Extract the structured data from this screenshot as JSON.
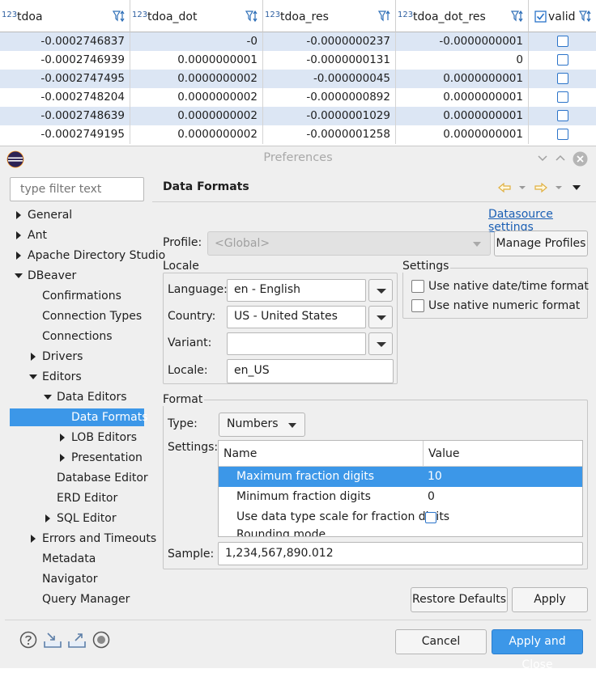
{
  "grid": {
    "columns": [
      {
        "type_badge": "123",
        "name": "tdoa"
      },
      {
        "type_badge": "123",
        "name": "tdoa_dot"
      },
      {
        "type_badge": "123",
        "name": "tdoa_res"
      },
      {
        "type_badge": "123",
        "name": "tdoa_dot_res"
      },
      {
        "type_badge": "",
        "name": "valid"
      }
    ],
    "rows": [
      [
        "-0.0002746837",
        "-0",
        "-0.0000000237",
        "-0.0000000001"
      ],
      [
        "-0.0002746939",
        "0.0000000001",
        "-0.0000000131",
        "0"
      ],
      [
        "-0.0002747495",
        "0.0000000002",
        "-0.000000045",
        "0.0000000001"
      ],
      [
        "-0.0002748204",
        "0.0000000002",
        "-0.0000000892",
        "0.0000000001"
      ],
      [
        "-0.0002748639",
        "0.0000000002",
        "-0.0000001029",
        "0.0000000001"
      ],
      [
        "-0.0002749195",
        "0.0000000002",
        "-0.0000001258",
        "0.0000000001"
      ]
    ]
  },
  "dialog": {
    "title": "Preferences",
    "filter_placeholder": "type filter text",
    "tree": [
      {
        "label": "General",
        "level": 0,
        "arrow": "right"
      },
      {
        "label": "Ant",
        "level": 0,
        "arrow": "right"
      },
      {
        "label": "Apache Directory Studio",
        "level": 0,
        "arrow": "right"
      },
      {
        "label": "DBeaver",
        "level": 0,
        "arrow": "down"
      },
      {
        "label": "Confirmations",
        "level": 1,
        "arrow": ""
      },
      {
        "label": "Connection Types",
        "level": 1,
        "arrow": ""
      },
      {
        "label": "Connections",
        "level": 1,
        "arrow": ""
      },
      {
        "label": "Drivers",
        "level": 1,
        "arrow": "right"
      },
      {
        "label": "Editors",
        "level": 1,
        "arrow": "down"
      },
      {
        "label": "Data Editors",
        "level": 2,
        "arrow": "down"
      },
      {
        "label": "Data Formats",
        "level": 3,
        "arrow": "",
        "selected": true
      },
      {
        "label": "LOB Editors",
        "level": 3,
        "arrow": "right"
      },
      {
        "label": "Presentation",
        "level": 3,
        "arrow": "right"
      },
      {
        "label": "Database Editor",
        "level": 2,
        "arrow": ""
      },
      {
        "label": "ERD Editor",
        "level": 2,
        "arrow": ""
      },
      {
        "label": "SQL Editor",
        "level": 2,
        "arrow": "right"
      },
      {
        "label": "Errors and Timeouts",
        "level": 1,
        "arrow": "right"
      },
      {
        "label": "Metadata",
        "level": 1,
        "arrow": ""
      },
      {
        "label": "Navigator",
        "level": 1,
        "arrow": ""
      },
      {
        "label": "Query Manager",
        "level": 1,
        "arrow": ""
      }
    ],
    "page_title": "Data Formats",
    "datasource_link": "Datasource settings",
    "profile_label": "Profile:",
    "profile_value": "<Global>",
    "manage_profiles": "Manage Profiles",
    "locale": {
      "group": "Locale",
      "language_label": "Language:",
      "language_value": "en - English",
      "country_label": "Country:",
      "country_value": "US - United States",
      "variant_label": "Variant:",
      "variant_value": "",
      "locale_label": "Locale:",
      "locale_value": "en_US"
    },
    "settings": {
      "group": "Settings",
      "native_datetime": "Use native date/time format",
      "native_numeric": "Use native numeric format"
    },
    "format": {
      "group": "Format",
      "type_label": "Type:",
      "type_value": "Numbers",
      "settings_label": "Settings:",
      "col_name": "Name",
      "col_value": "Value",
      "rows": [
        {
          "name": "Maximum fraction digits",
          "value": "10"
        },
        {
          "name": "Minimum fraction digits",
          "value": "0"
        },
        {
          "name": "Use data type scale for fraction digits",
          "value": ""
        },
        {
          "name": "Rounding mode",
          "value": ""
        }
      ],
      "sample_label": "Sample:",
      "sample_value": "1,234,567,890.012"
    },
    "restore_defaults": "Restore Defaults",
    "apply": "Apply",
    "cancel": "Cancel",
    "apply_close": "Apply and Close",
    "colors": {
      "accent": "#3c97e8",
      "selection": "#3c97e8",
      "link": "#1a5fb4",
      "row_alt": "#dce6f4"
    }
  }
}
